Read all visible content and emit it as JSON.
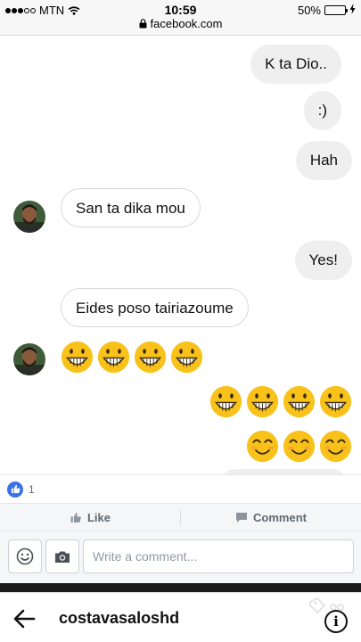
{
  "status_bar": {
    "carrier": "MTN",
    "time": "10:59",
    "url": "facebook.com",
    "battery": "50%",
    "battery_level": 0.5,
    "icons": [
      "signal-dots-icon",
      "wifi-icon",
      "lock-icon",
      "battery-icon",
      "charging-icon"
    ]
  },
  "chat": {
    "messages": [
      {
        "direction": "outgoing",
        "text": "K ta Dio.."
      },
      {
        "direction": "outgoing",
        "text": ":)"
      },
      {
        "direction": "outgoing",
        "text": "Hah"
      },
      {
        "direction": "incoming",
        "text": "San ta dika mou"
      },
      {
        "direction": "outgoing",
        "text": "Yes!"
      },
      {
        "direction": "incoming",
        "text": "Eides poso tairiazoume"
      },
      {
        "direction": "incoming",
        "emoji": "grinning-face",
        "count": 4
      },
      {
        "direction": "outgoing",
        "emoji": "grinning-face",
        "count": 4
      },
      {
        "direction": "outgoing",
        "emoji": "smiling-face",
        "count": 3
      }
    ],
    "colors": {
      "outgoing_bubble": "#efefef",
      "incoming_bubble_border": "#d8d8d8",
      "emoji_yellow": "#f8c21a"
    }
  },
  "reactions": {
    "like_count": "1",
    "icon": "like-reaction-icon",
    "accent": "#3b71e8"
  },
  "actions": {
    "like_label": "Like",
    "comment_label": "Comment"
  },
  "composer": {
    "placeholder": "Write a comment..."
  },
  "profile_bar": {
    "username": "costavasaloshd",
    "info_label": "i"
  }
}
